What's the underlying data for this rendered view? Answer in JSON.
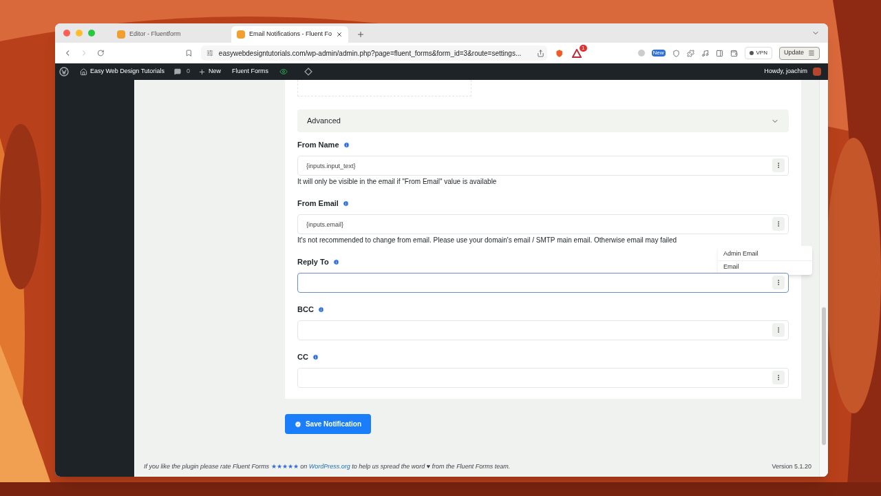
{
  "browser": {
    "tabs": [
      {
        "title": "Editor - Fluentform",
        "selected": false
      },
      {
        "title": "Email Notifications - Fluent Fo",
        "selected": true
      }
    ],
    "url": "easywebdesigntutorials.com/wp-admin/admin.php?page=fluent_forms&form_id=3&route=settings...",
    "alert_count": "1",
    "new_badge": "New",
    "vpn": "VPN",
    "update": "Update"
  },
  "admin_bar": {
    "site": "Easy Web Design Tutorials",
    "comments": "0",
    "new": "New",
    "plugin": "Fluent Forms",
    "greeting": "Howdy, joachim"
  },
  "section": {
    "title": "Advanced",
    "expanded": true
  },
  "fields": [
    {
      "label": "From Name",
      "value": "{inputs.input_text}",
      "help": "It will only be visible in the email if \"From Email\" value is available",
      "focused": false
    },
    {
      "label": "From Email",
      "value": "{inputs.email}",
      "help": "It's not recommended to change from email. Please use your domain's email / SMTP main email. Otherwise email may failed",
      "focused": false
    },
    {
      "label": "Reply To",
      "focused": true
    },
    {
      "label": "BCC",
      "focused": false
    },
    {
      "label": "CC",
      "focused": false
    }
  ],
  "dropdown": {
    "items": [
      "Admin Email",
      "Email"
    ]
  },
  "save_button": "Save Notification",
  "footer": {
    "before": "If you like the plugin please rate Fluent Forms",
    "stars": "★★★★★",
    "on": "on",
    "link": "WordPress.org",
    "after": "to help us spread the word ♥ from the Fluent Forms team.",
    "version": "Version 5.1.20"
  }
}
